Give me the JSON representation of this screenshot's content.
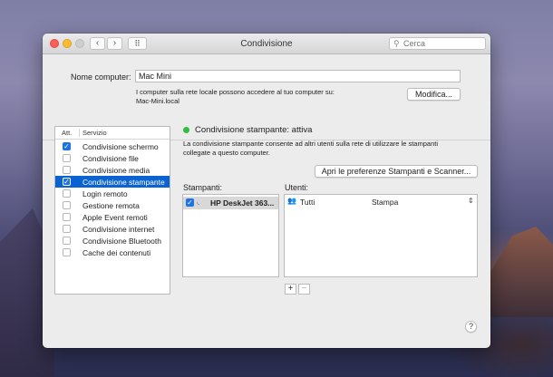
{
  "window": {
    "title": "Condivisione",
    "search_placeholder": "Cerca",
    "nav_back": "‹",
    "nav_forward": "›",
    "grid_glyph": "⠿"
  },
  "computer": {
    "name_label": "Nome computer:",
    "name_value": "Mac Mini",
    "info_line1": "I computer sulla rete locale possono accedere al tuo computer su:",
    "info_line2": "Mac-Mini.local",
    "edit_button": "Modifica..."
  },
  "services": {
    "col_on": "Att.",
    "col_service": "Servizio",
    "items": [
      {
        "label": "Condivisione schermo",
        "checked": true,
        "selected": false
      },
      {
        "label": "Condivisione file",
        "checked": false,
        "selected": false
      },
      {
        "label": "Condivisione media",
        "checked": false,
        "selected": false
      },
      {
        "label": "Condivisione stampante",
        "checked": true,
        "selected": true
      },
      {
        "label": "Login remoto",
        "checked": false,
        "selected": false
      },
      {
        "label": "Gestione remota",
        "checked": false,
        "selected": false
      },
      {
        "label": "Apple Event remoti",
        "checked": false,
        "selected": false
      },
      {
        "label": "Condivisione internet",
        "checked": false,
        "selected": false
      },
      {
        "label": "Condivisione Bluetooth",
        "checked": false,
        "selected": false
      },
      {
        "label": "Cache dei contenuti",
        "checked": false,
        "selected": false
      }
    ]
  },
  "detail": {
    "status_text": "Condivisione stampante: attiva",
    "status_color": "#2fbf3a",
    "desc_line1": "La condivisione stampante consente ad altri utenti sulla rete di utilizzare le stampanti",
    "desc_line2": "collegate a questo computer.",
    "prefs_button": "Apri le preferenze Stampanti e Scanner...",
    "printers_label": "Stampanti:",
    "users_label": "Utenti:",
    "printers": [
      {
        "name": "HP DeskJet 363...",
        "checked": true
      }
    ],
    "users": [
      {
        "name": "Tutti",
        "permission": "Stampa"
      }
    ],
    "add_button": "+",
    "remove_button": "−"
  },
  "help_button": "?",
  "accent_color": "#0a63d1"
}
